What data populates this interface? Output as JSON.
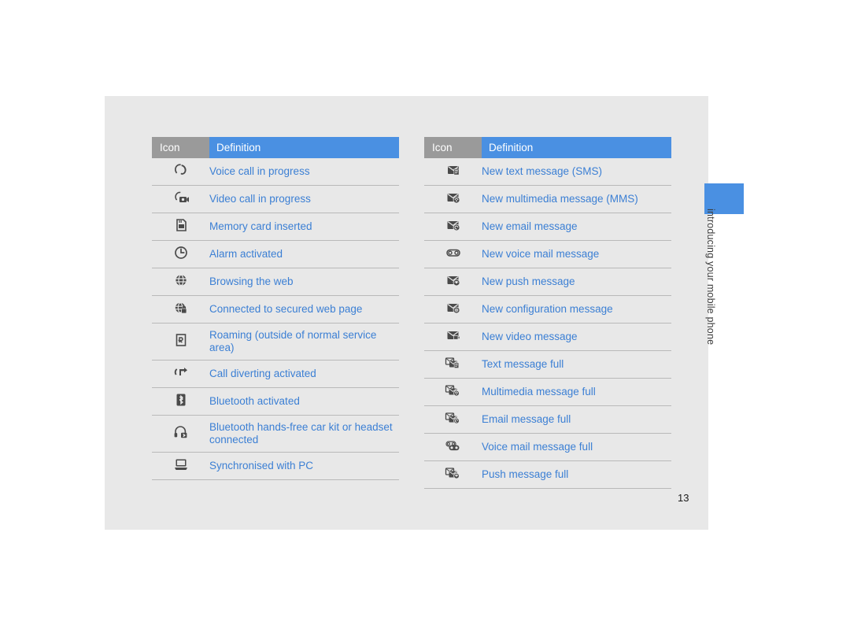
{
  "page": {
    "number": "13",
    "side_label": "introducing your mobile phone"
  },
  "columns": [
    {
      "headers": {
        "icon": "Icon",
        "definition": "Definition"
      },
      "rows": [
        {
          "icon": "voice-call-icon",
          "definition": "Voice call in progress"
        },
        {
          "icon": "video-call-icon",
          "definition": "Video call in progress"
        },
        {
          "icon": "memory-card-icon",
          "definition": "Memory card inserted"
        },
        {
          "icon": "alarm-clock-icon",
          "definition": "Alarm activated"
        },
        {
          "icon": "globe-web-icon",
          "definition": "Browsing the web"
        },
        {
          "icon": "secure-web-icon",
          "definition": "Connected to secured web page"
        },
        {
          "icon": "roaming-icon",
          "definition": "Roaming (outside of normal service area)"
        },
        {
          "icon": "call-divert-icon",
          "definition": "Call diverting activated"
        },
        {
          "icon": "bluetooth-icon",
          "definition": "Bluetooth activated"
        },
        {
          "icon": "bluetooth-headset-icon",
          "definition": "Bluetooth hands-free car kit or headset connected"
        },
        {
          "icon": "sync-pc-icon",
          "definition": "Synchronised with PC"
        }
      ]
    },
    {
      "headers": {
        "icon": "Icon",
        "definition": "Definition"
      },
      "rows": [
        {
          "icon": "new-sms-icon",
          "definition": "New text message (SMS)"
        },
        {
          "icon": "new-mms-icon",
          "definition": "New multimedia message (MMS)"
        },
        {
          "icon": "new-email-icon",
          "definition": "New email message"
        },
        {
          "icon": "new-voicemail-icon",
          "definition": "New voice mail message"
        },
        {
          "icon": "new-push-message-icon",
          "definition": "New push message"
        },
        {
          "icon": "new-configuration-message-icon",
          "definition": "New configuration message"
        },
        {
          "icon": "new-video-message-icon",
          "definition": "New video message"
        },
        {
          "icon": "text-message-full-icon",
          "definition": "Text message full"
        },
        {
          "icon": "multimedia-message-full-icon",
          "definition": "Multimedia message full"
        },
        {
          "icon": "email-message-full-icon",
          "definition": "Email message full"
        },
        {
          "icon": "voice-mail-full-icon",
          "definition": "Voice mail message full"
        },
        {
          "icon": "push-message-full-icon",
          "definition": "Push message full"
        }
      ]
    }
  ],
  "colors": {
    "accent": "#4a90e2",
    "link_text": "#3b7fd4",
    "header_icon_bg": "#9a9a9a",
    "page_bg": "#e8e8e8"
  }
}
